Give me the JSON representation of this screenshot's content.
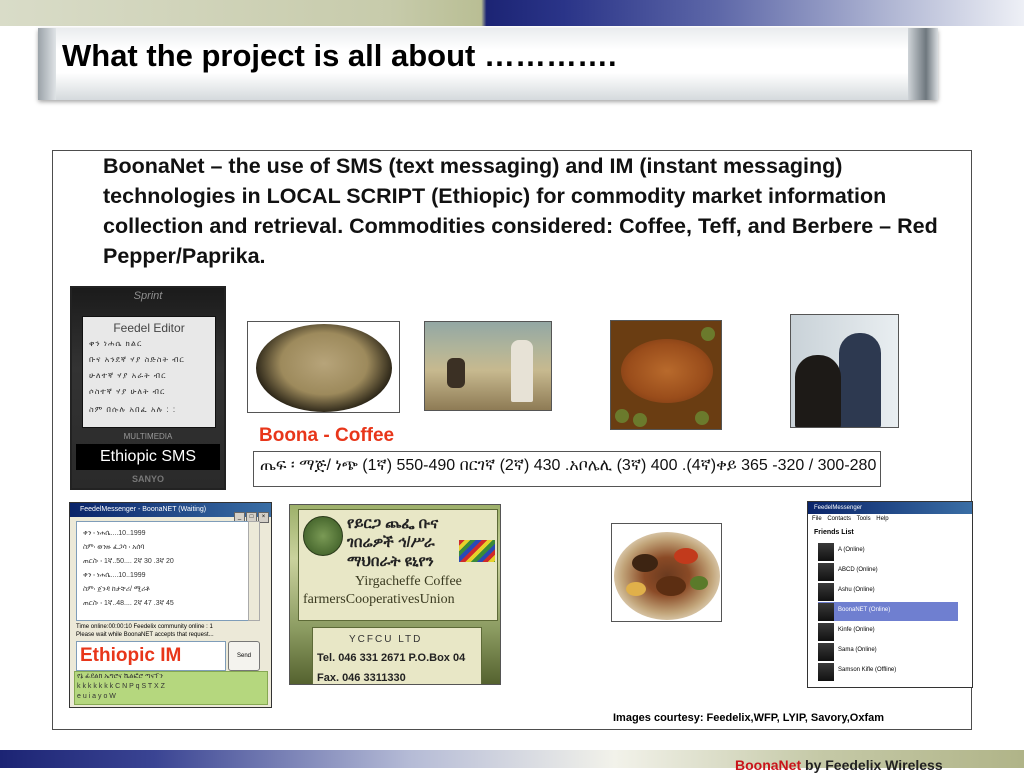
{
  "slide": {
    "title": "What the project is all about ………….",
    "intro": "BoonaNet – the use of SMS (text messaging) and IM (instant messaging) technologies in LOCAL SCRIPT (Ethiopic) for commodity market information collection and retrieval. Commodities considered: Coffee, Teff, and Berbere – Red Pepper/Paprika."
  },
  "phone": {
    "brand": "Sprint",
    "editor_title": "Feedel Editor",
    "rows": [
      "ቀን  ነሐሴ  ክልር",
      "ቡና  አንደኛ  ሃያ  ስድስት  ብር",
      "    ሁለተኛ  ሃያ  አራት  ብር",
      "    ሶስተኛ  ሃያ  ሁለት  ብር",
      "ስም  በሱሉ  አበፈ  አሉ : :"
    ],
    "multimedia": "MULTIMEDIA",
    "label": "Ethiopic SMS",
    "maker": "SANYO"
  },
  "coffee": {
    "label": "Boona - Coffee",
    "price_line": "ጤፍ ፡ ማጅ/ ነጭ (1ኛ) 550-490 በርገኛ (2ኛ) 430 .አቦሌሊ (3ኛ) 400 .(4ኛ)ቀይ 365 -320 / 300-280"
  },
  "messenger": {
    "title": "FeedelMessenger - BoonaNET (Waiting)",
    "chat_lines": [
      "ቀን ፡ ነሐሴ....10..1999",
      "ስም፡ ወንዙ ፈጋሳ ፡ አሰባ",
      "ጠርስ፡ ፡ 1ኛ..50.... 2ኛ 30 .3ኛ 20",
      "ቀን ፡ ነሐሴ....10..1999",
      "ስም፡ ጀንዳ ከታቸሪ/  ሚሪቶ",
      "ጠርስ፡ ፡ 1ኛ..48.... 2ኛ 47 .3ኛ 45"
    ],
    "status_line1": "Time online:00:00:10      Feedelix community online : 1",
    "status_line2": "Please wait while BoonaNET accepts that request...",
    "send": "Send",
    "label": "Ethiopic IM",
    "keys_row1": "የኔ ፊደልክ ኤግሮና ሼልፎሮ ጣናፕን",
    "keys_row2": "k    k    k    k    k    k    k     C  N  P  q  S  T  X  Z",
    "keys_row3": "e    u    i    a    y         o   W"
  },
  "sign": {
    "amharic_line1": "የይርጋ ጨፌ ቡና",
    "amharic_line2": "ገበሬዎች ኅ/ሥራ",
    "amharic_line3": "ማህበራት ዩኒየን",
    "english_line1": "Yirgacheffe Coffee",
    "english_line2": "farmersCooperativesUnion",
    "ycfcu": "YCFCU  LTD",
    "tel": "Tel. 046 331 2671   P.O.Box 04",
    "fax": "Fax. 046 3311330"
  },
  "friends": {
    "title": "FeedelMessenger",
    "menu": "File Contacts Tools Help",
    "heading": "Friends List",
    "list": [
      "A (Online)",
      "ABCD (Online)",
      "Ashu (Online)",
      "BoonaNET (Online)",
      "Kinfe (Online)",
      "Sama (Online)",
      "Samson Kifle (Offline)"
    ],
    "selected_index": 3
  },
  "credit": "Images courtesy: Feedelix,WFP, LYIP, Savory,Oxfam",
  "footer": {
    "brand": "BoonaNet",
    "rest": " by Feedelix Wireless"
  },
  "colors": {
    "accent_red": "#e8361a",
    "navy": "#1c2474",
    "olive": "#c7cbab"
  }
}
